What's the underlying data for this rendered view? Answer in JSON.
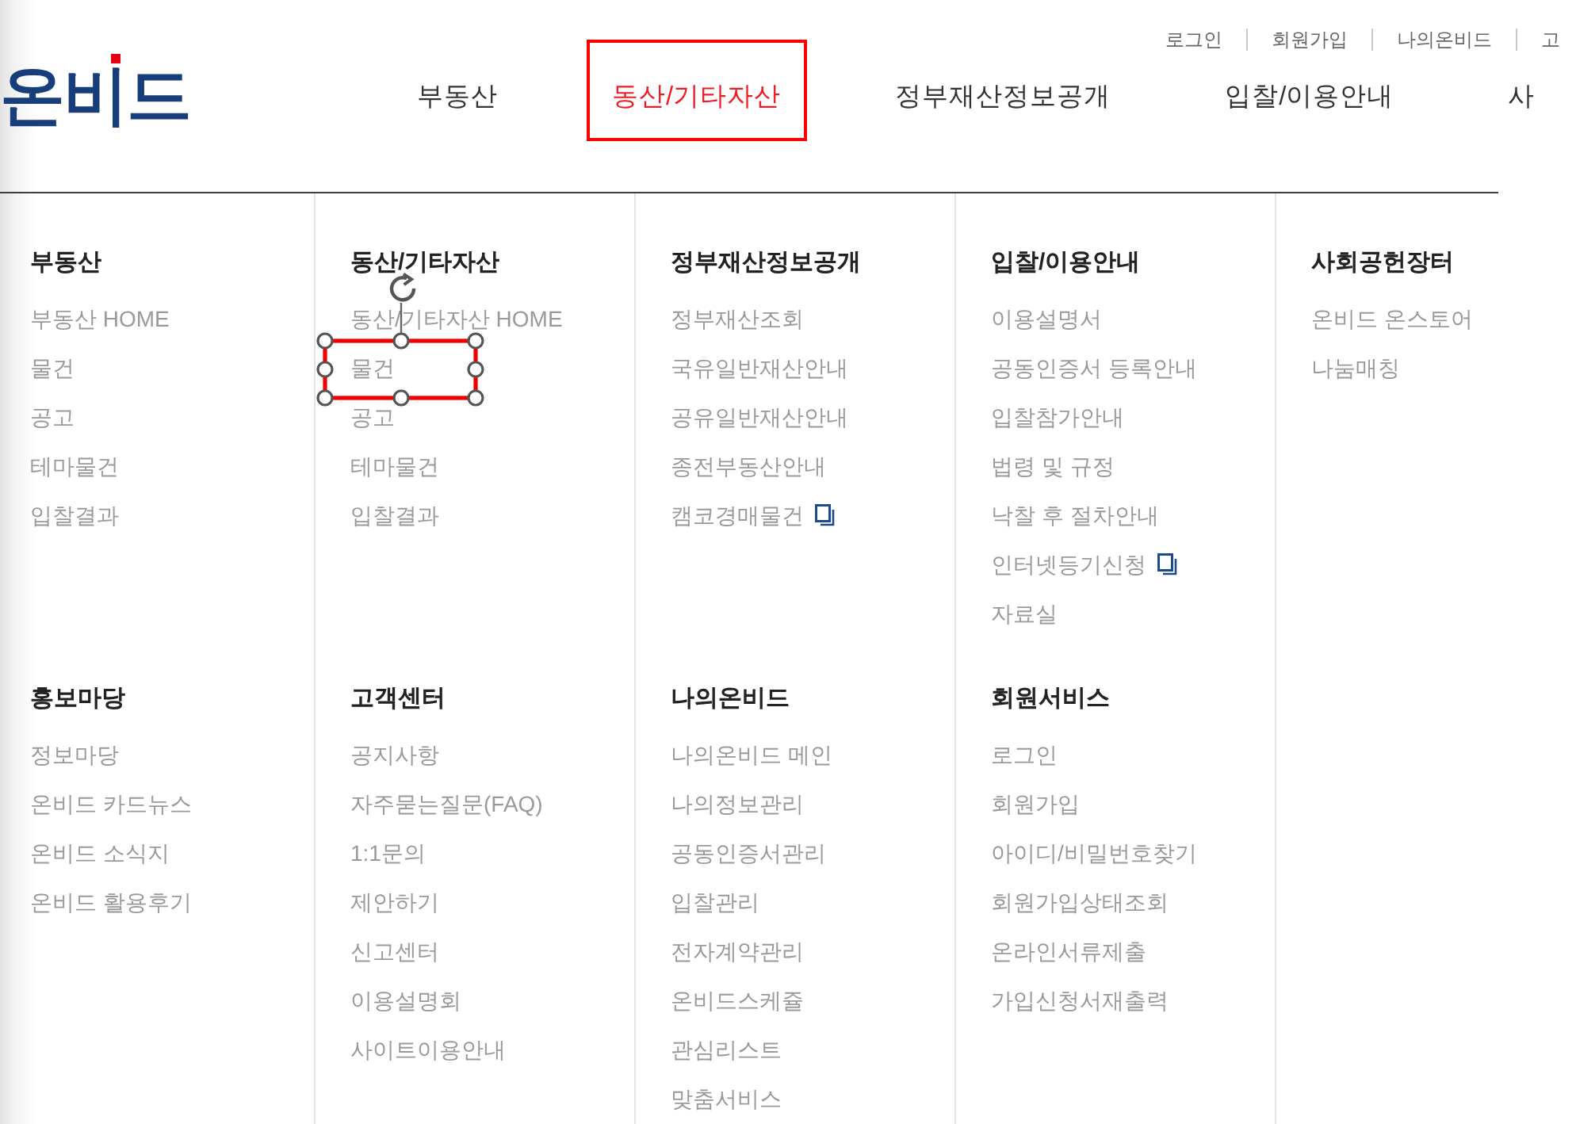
{
  "utility_links": [
    "로그인",
    "회원가입",
    "나의온비드",
    "고"
  ],
  "logo": {
    "text": "온비드"
  },
  "nav": [
    {
      "label": "부동산",
      "selected": false
    },
    {
      "label": "동산/기타자산",
      "selected": true
    },
    {
      "label": "정부재산정보공개",
      "selected": false
    },
    {
      "label": "입찰/이용안내",
      "selected": false
    },
    {
      "label": "사",
      "selected": false
    }
  ],
  "menu_rows": [
    [
      {
        "title": "부동산",
        "items": [
          {
            "label": "부동산 HOME",
            "new_window": false,
            "framed": false
          },
          {
            "label": "물건",
            "new_window": false,
            "framed": false
          },
          {
            "label": "공고",
            "new_window": false,
            "framed": false
          },
          {
            "label": "테마물건",
            "new_window": false,
            "framed": false
          },
          {
            "label": "입찰결과",
            "new_window": false,
            "framed": false
          }
        ]
      },
      {
        "title": "동산/기타자산",
        "items": [
          {
            "label": "동산/기타자산 HOME",
            "new_window": false,
            "framed": false
          },
          {
            "label": "물건",
            "new_window": false,
            "framed": true
          },
          {
            "label": "공고",
            "new_window": false,
            "framed": false
          },
          {
            "label": "테마물건",
            "new_window": false,
            "framed": false
          },
          {
            "label": "입찰결과",
            "new_window": false,
            "framed": false
          }
        ]
      },
      {
        "title": "정부재산정보공개",
        "items": [
          {
            "label": "정부재산조회",
            "new_window": false,
            "framed": false
          },
          {
            "label": "국유일반재산안내",
            "new_window": false,
            "framed": false
          },
          {
            "label": "공유일반재산안내",
            "new_window": false,
            "framed": false
          },
          {
            "label": "종전부동산안내",
            "new_window": false,
            "framed": false
          },
          {
            "label": "캠코경매물건",
            "new_window": true,
            "framed": false
          }
        ]
      },
      {
        "title": "입찰/이용안내",
        "items": [
          {
            "label": "이용설명서",
            "new_window": false,
            "framed": false
          },
          {
            "label": "공동인증서 등록안내",
            "new_window": false,
            "framed": false
          },
          {
            "label": "입찰참가안내",
            "new_window": false,
            "framed": false
          },
          {
            "label": "법령 및 규정",
            "new_window": false,
            "framed": false
          },
          {
            "label": "낙찰 후 절차안내",
            "new_window": false,
            "framed": false
          },
          {
            "label": "인터넷등기신청",
            "new_window": true,
            "framed": false
          },
          {
            "label": "자료실",
            "new_window": false,
            "framed": false
          }
        ]
      },
      {
        "title": "사회공헌장터",
        "items": [
          {
            "label": "온비드 온스토어",
            "new_window": false,
            "framed": false
          },
          {
            "label": "나눔매칭",
            "new_window": false,
            "framed": false
          }
        ]
      }
    ],
    [
      {
        "title": "홍보마당",
        "items": [
          {
            "label": "정보마당",
            "new_window": false,
            "framed": false
          },
          {
            "label": "온비드 카드뉴스",
            "new_window": false,
            "framed": false
          },
          {
            "label": "온비드 소식지",
            "new_window": false,
            "framed": false
          },
          {
            "label": "온비드 활용후기",
            "new_window": false,
            "framed": false
          }
        ]
      },
      {
        "title": "고객센터",
        "items": [
          {
            "label": "공지사항",
            "new_window": false,
            "framed": false
          },
          {
            "label": "자주묻는질문(FAQ)",
            "new_window": false,
            "framed": false
          },
          {
            "label": "1:1문의",
            "new_window": false,
            "framed": false
          },
          {
            "label": "제안하기",
            "new_window": false,
            "framed": false
          },
          {
            "label": "신고센터",
            "new_window": false,
            "framed": false
          },
          {
            "label": "이용설명회",
            "new_window": false,
            "framed": false
          },
          {
            "label": "사이트이용안내",
            "new_window": false,
            "framed": false
          }
        ]
      },
      {
        "title": "나의온비드",
        "items": [
          {
            "label": "나의온비드 메인",
            "new_window": false,
            "framed": false
          },
          {
            "label": "나의정보관리",
            "new_window": false,
            "framed": false
          },
          {
            "label": "공동인증서관리",
            "new_window": false,
            "framed": false
          },
          {
            "label": "입찰관리",
            "new_window": false,
            "framed": false
          },
          {
            "label": "전자계약관리",
            "new_window": false,
            "framed": false
          },
          {
            "label": "온비드스케쥴",
            "new_window": false,
            "framed": false
          },
          {
            "label": "관심리스트",
            "new_window": false,
            "framed": false
          },
          {
            "label": "맞춤서비스",
            "new_window": false,
            "framed": false
          }
        ]
      },
      {
        "title": "회원서비스",
        "items": [
          {
            "label": "로그인",
            "new_window": false,
            "framed": false
          },
          {
            "label": "회원가입",
            "new_window": false,
            "framed": false
          },
          {
            "label": "아이디/비밀번호찾기",
            "new_window": false,
            "framed": false
          },
          {
            "label": "회원가입상태조회",
            "new_window": false,
            "framed": false
          },
          {
            "label": "온라인서류제출",
            "new_window": false,
            "framed": false
          },
          {
            "label": "가입신청서재출력",
            "new_window": false,
            "framed": false
          }
        ]
      }
    ]
  ]
}
